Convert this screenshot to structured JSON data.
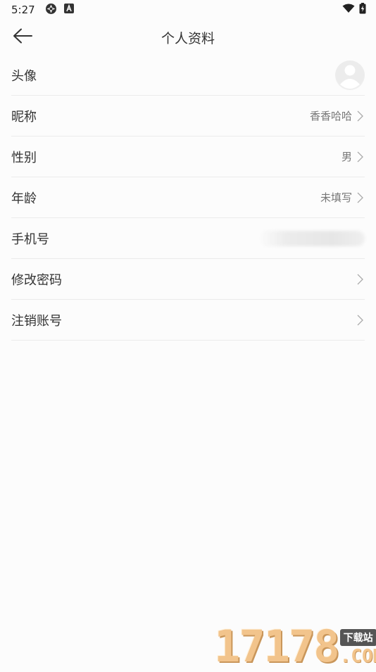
{
  "status_bar": {
    "time": "5:27"
  },
  "header": {
    "title": "个人资料"
  },
  "profile_rows": [
    {
      "label": "头像"
    },
    {
      "label": "昵称",
      "value": "香香哈哈"
    },
    {
      "label": "性别",
      "value": "男"
    },
    {
      "label": "年龄",
      "value": "未填写"
    },
    {
      "label": "手机号"
    },
    {
      "label": "修改密码"
    },
    {
      "label": "注销账号"
    }
  ],
  "watermark": {
    "digits": "17178",
    "tag": "下载站",
    "domain": ".COM"
  }
}
